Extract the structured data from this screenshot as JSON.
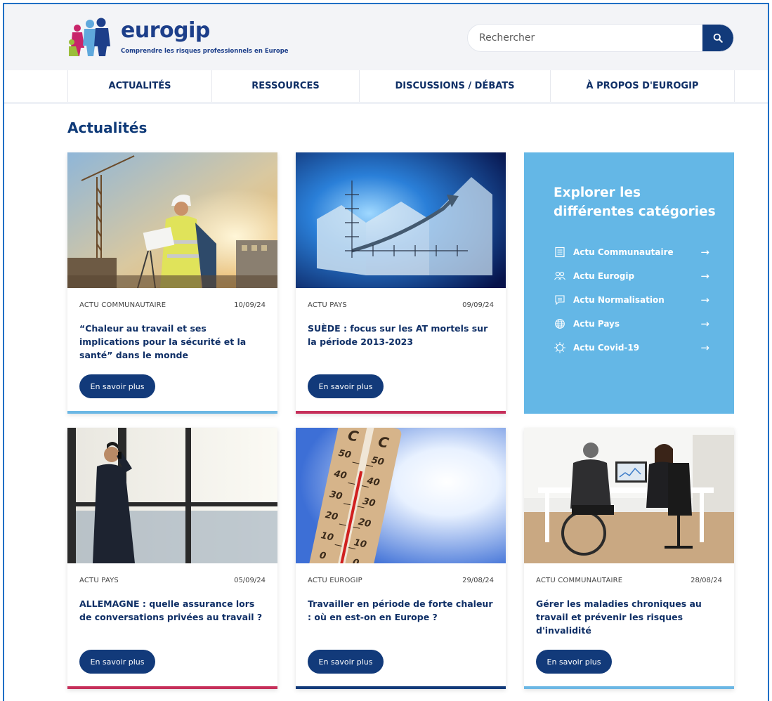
{
  "header": {
    "brand": "eurogip",
    "tagline": "Comprendre les risques professionnels en Europe",
    "search_placeholder": "Rechercher"
  },
  "nav": [
    {
      "label": "ACTUALITÉS"
    },
    {
      "label": "RESSOURCES"
    },
    {
      "label": "DISCUSSIONS / DÉBATS"
    },
    {
      "label": "À PROPOS D'EUROGIP"
    }
  ],
  "section_title": "Actualités",
  "button_label": "En savoir plus",
  "cards": [
    {
      "category": "ACTU COMMUNAUTAIRE",
      "date": "10/09/24",
      "title": "“Chaleur au travail et ses implications pour la sécurité et la santé” dans le monde",
      "bar_color": "#6bb7e4"
    },
    {
      "category": "ACTU PAYS",
      "date": "09/09/24",
      "title": "SUÈDE : focus sur les AT mortels sur la période 2013-2023",
      "bar_color": "#c62f5a"
    },
    {
      "category": "ACTU PAYS",
      "date": "05/09/24",
      "title": "ALLEMAGNE : quelle assurance lors de conversations privées au travail ?",
      "bar_color": "#c62f5a"
    },
    {
      "category": "ACTU EUROGIP",
      "date": "29/08/24",
      "title": "Travailler en période de forte chaleur : où en est-on en Europe ?",
      "bar_color": "#123a7a"
    },
    {
      "category": "ACTU COMMUNAUTAIRE",
      "date": "28/08/24",
      "title": "Gérer les maladies chroniques au travail et prévenir les risques d'invalidité",
      "bar_color": "#6bb7e4"
    }
  ],
  "explore": {
    "title": "Explorer les différentes catégories",
    "items": [
      {
        "label": "Actu Communautaire",
        "icon": "newspaper-icon"
      },
      {
        "label": "Actu Eurogip",
        "icon": "users-icon"
      },
      {
        "label": "Actu Normalisation",
        "icon": "chat-icon"
      },
      {
        "label": "Actu Pays",
        "icon": "globe-icon"
      },
      {
        "label": "Actu Covid-19",
        "icon": "virus-icon"
      }
    ],
    "arrow": "→"
  },
  "colors": {
    "navy": "#123a7a",
    "light_blue": "#64b7e6",
    "crimson": "#c62f5a"
  }
}
